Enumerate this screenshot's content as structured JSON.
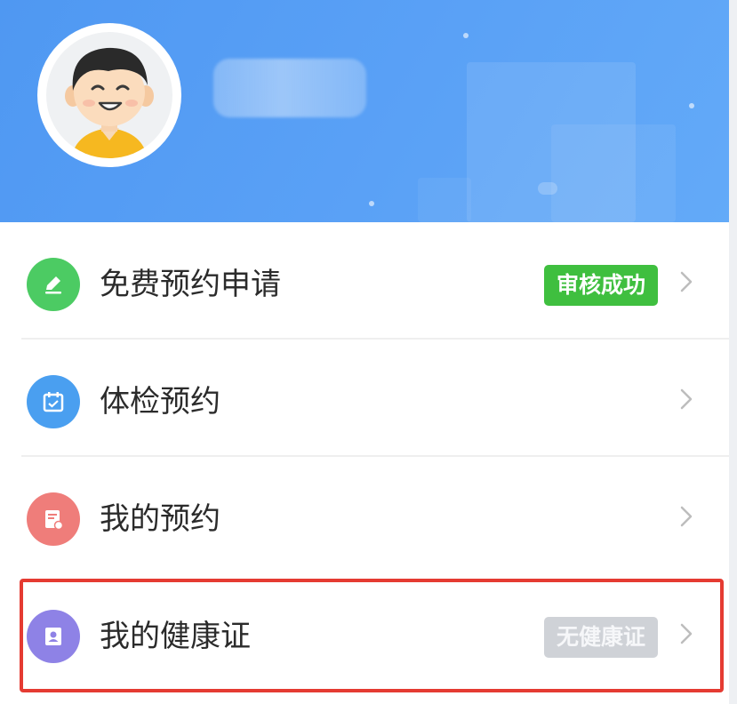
{
  "profile": {
    "avatar_icon": "boy-avatar-icon",
    "username": ""
  },
  "menu": {
    "items": [
      {
        "label": "免费预约申请",
        "icon": "pencil-icon",
        "icon_color": "#4ccb63",
        "badge": "审核成功",
        "badge_color": "#3fbf3f"
      },
      {
        "label": "体检预约",
        "icon": "calendar-icon",
        "icon_color": "#4a9ff0",
        "badge": ""
      },
      {
        "label": "我的预约",
        "icon": "document-icon",
        "icon_color": "#ef7d7a",
        "badge": ""
      },
      {
        "label": "我的健康证",
        "icon": "id-card-icon",
        "icon_color": "#8e82e6",
        "badge": "无健康证",
        "badge_color": "#cfd2d7"
      }
    ]
  },
  "colors": {
    "header_bg": "#5aa1f6",
    "highlight_border": "#e53b32"
  }
}
